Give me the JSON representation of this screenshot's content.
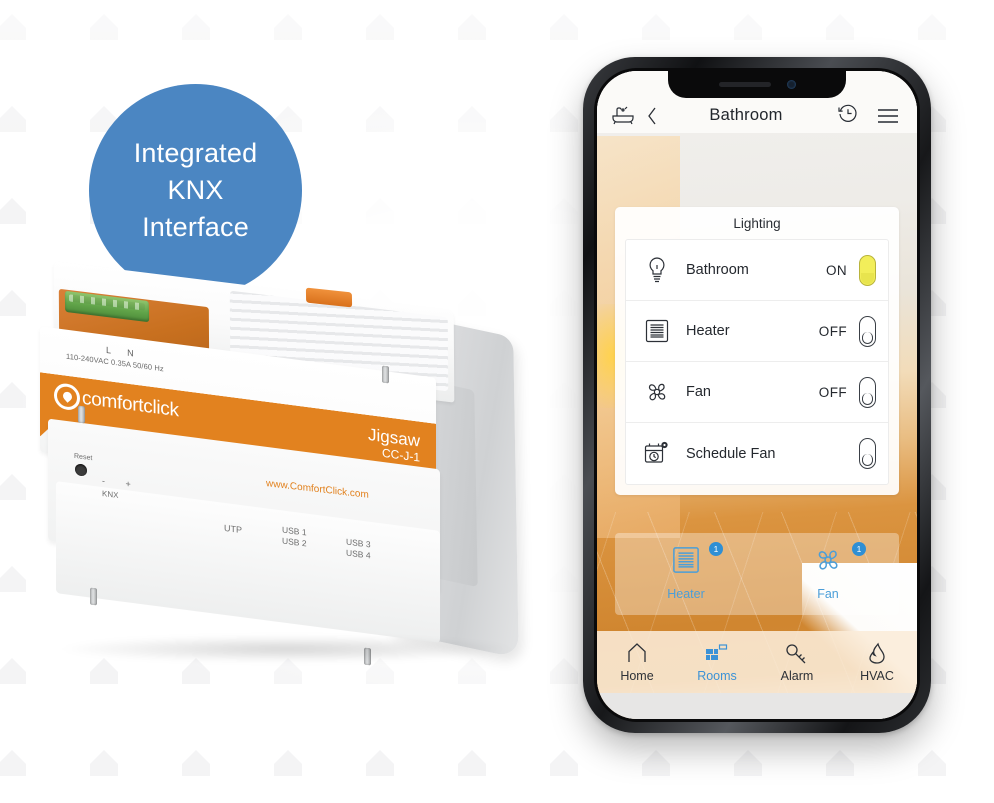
{
  "badge": {
    "line1": "Integrated",
    "line2": "KNX",
    "line3": "Interface",
    "color": "#4b86c2"
  },
  "device": {
    "brand_name": "comfortclick",
    "model_name": "Jigsaw",
    "model_code": "CC-J-1",
    "website": "www.ComfortClick.com",
    "power_terminals": "L    N",
    "power_rating": "110-240VAC 0.35A 50/60 Hz",
    "reset_label": "Reset",
    "knx_label": "KNX",
    "knx_polarity": "-   +",
    "utp_label": "UTP",
    "usb_12": "USB 1\nUSB 2",
    "usb_1": "USB 1",
    "usb_2": "USB 2",
    "usb_3": "USB 3",
    "usb_4": "USB 4",
    "band_color": "#e2821f"
  },
  "phone": {
    "appbar": {
      "room_icon": "bathtub-icon",
      "back_icon": "chevron-left-icon",
      "title": "Bathroom",
      "history_icon": "clock-history-icon",
      "menu_icon": "hamburger-menu-icon"
    },
    "lighting_card": {
      "header": "Lighting",
      "rows": [
        {
          "icon": "lightbulb-icon",
          "name": "Bathroom",
          "state": "ON",
          "toggle": "on"
        },
        {
          "icon": "heater-icon",
          "name": "Heater",
          "state": "OFF",
          "toggle": "off"
        },
        {
          "icon": "fan-icon",
          "name": "Fan",
          "state": "OFF",
          "toggle": "off"
        },
        {
          "icon": "schedule-icon",
          "name": "Schedule Fan",
          "state": "",
          "toggle": "off"
        }
      ]
    },
    "favorites": [
      {
        "icon": "heater-icon",
        "label": "Heater",
        "badge": "1"
      },
      {
        "icon": "fan-icon",
        "label": "Fan",
        "badge": "1"
      }
    ],
    "tabs": [
      {
        "icon": "home-icon",
        "label": "Home",
        "active": false
      },
      {
        "icon": "rooms-icon",
        "label": "Rooms",
        "active": true
      },
      {
        "icon": "key-icon",
        "label": "Alarm",
        "active": false
      },
      {
        "icon": "flame-icon",
        "label": "HVAC",
        "active": false
      }
    ],
    "accent_color": "#3c92d6",
    "toggle_on_color": "#f2ee5a"
  }
}
